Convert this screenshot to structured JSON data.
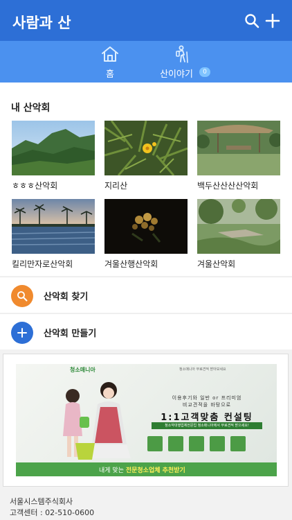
{
  "header": {
    "title": "사람과 산"
  },
  "icons": {
    "search": "search-icon",
    "add": "plus-icon",
    "home": "home-icon",
    "story": "hiker-icon"
  },
  "tabs": [
    {
      "label": "홈",
      "active": true
    },
    {
      "label": "산이야기",
      "badge": "0"
    }
  ],
  "clubs": {
    "title": "내 산악회",
    "items": [
      {
        "name": "ㅎㅎㅎ산악회",
        "thumb": "mountain-photo"
      },
      {
        "name": "지리산",
        "thumb": "wildflower-photo"
      },
      {
        "name": "백두산산산산악회",
        "thumb": "thatched-hut-photo"
      },
      {
        "name": "킬리만자로산악회",
        "thumb": "palm-pool-photo"
      },
      {
        "name": "겨울산행산악회",
        "thumb": "night-flower-photo"
      },
      {
        "name": "겨울산악회",
        "thumb": "garden-photo"
      }
    ]
  },
  "actions": {
    "find": {
      "label": "산악회 찾기",
      "color": "#f08a2e"
    },
    "create": {
      "label": "산악회 만들기",
      "color": "#2d6fd6"
    }
  },
  "ad": {
    "brand": "청소매니아",
    "top_note": "청소매니아 무료견적 받아보세요",
    "line1": "이용후기와 일반 or 프리미엄",
    "line2": "비교견적을 바탕으로",
    "headline": "1:1고객맞춤 컨설팅",
    "sub": "청소약대행업체전문업 청소매니아에서 무료견적 받으세요!",
    "bottom_prefix": "내게 맞는 ",
    "bottom_emph": "전문청소업체 추천받기"
  },
  "footer": {
    "company": "서울시스템주식회사",
    "support": "고객센터 : 02-510-0600"
  },
  "colors": {
    "header": "#2d6fd6",
    "tabbar": "#4b91ef",
    "badge": "#7fc3ff",
    "ad_green": "#4ca34a"
  }
}
